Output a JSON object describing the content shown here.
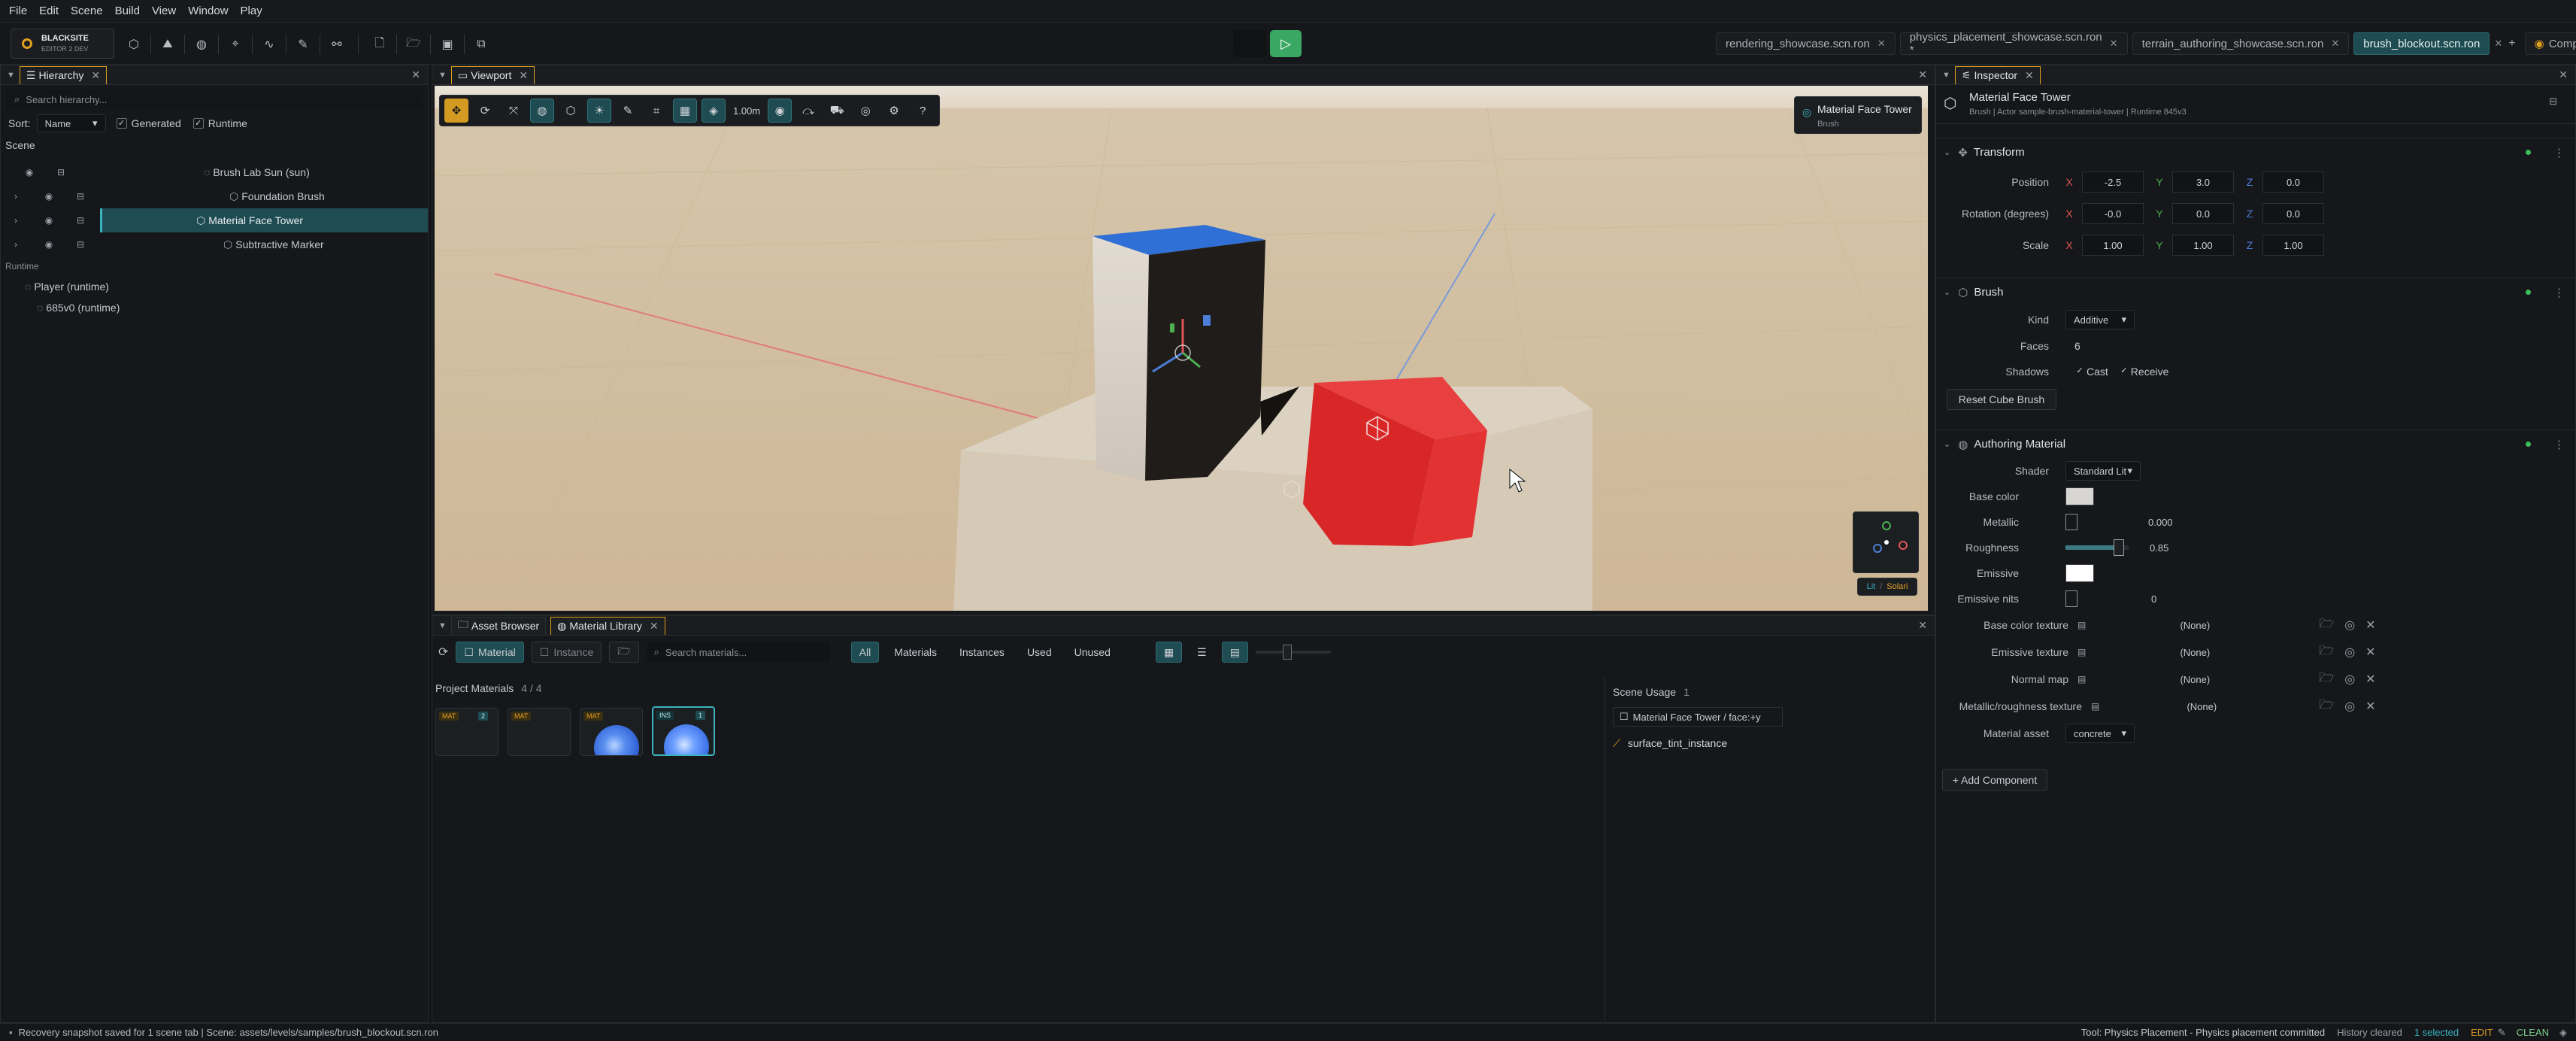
{
  "menubar": {
    "items": [
      "File",
      "Edit",
      "Scene",
      "Build",
      "View",
      "Window",
      "Play"
    ]
  },
  "brand": {
    "name": "BLACKSITE",
    "sub": "EDITOR 2 DEV"
  },
  "doc_tabs": [
    {
      "label": "rendering_showcase.scn.ron",
      "active": false
    },
    {
      "label": "physics_placement_showcase.scn.ron *",
      "active": false
    },
    {
      "label": "terrain_authoring_showcase.scn.ron",
      "active": false
    },
    {
      "label": "brush_blockout.scn.ron",
      "active": true
    }
  ],
  "composition_label": "Composition",
  "hierarchy": {
    "tab": "Hierarchy",
    "search_placeholder": "Search hierarchy...",
    "sort_label": "Sort:",
    "sort_value": "Name",
    "toggle_generated": "Generated",
    "toggle_runtime": "Runtime",
    "scene_header": "Scene",
    "scene_items": [
      {
        "label": "Brush Lab Sun  (sun)"
      },
      {
        "label": "Foundation Brush"
      },
      {
        "label": "Material Face Tower",
        "selected": true
      },
      {
        "label": "Subtractive Marker"
      }
    ],
    "runtime_header": "Runtime",
    "runtime_items": [
      "Player  (runtime)",
      "685v0  (runtime)"
    ]
  },
  "viewport": {
    "tab": "Viewport",
    "snap_value": "1.00m",
    "overlay_title": "Material Face Tower",
    "overlay_sub": "Brush",
    "lit_label": "Lit",
    "solari_label": "Solari"
  },
  "bottom": {
    "tab_assets": "Asset Browser",
    "tab_materials": "Material Library",
    "mode_material": "Material",
    "mode_instance": "Instance",
    "search_placeholder": "Search materials...",
    "filters": [
      "All",
      "Materials",
      "Instances",
      "Used",
      "Unused"
    ],
    "project_label": "Project Materials",
    "project_count": "4  /  4",
    "tiles": [
      {
        "badge": "MAT",
        "badge2": "2",
        "kind": "dark"
      },
      {
        "badge": "MAT",
        "badge2": "",
        "kind": "dark"
      },
      {
        "badge": "MAT",
        "badge2": "",
        "kind": "sphere"
      },
      {
        "badge": "INS",
        "badge2": "1",
        "kind": "sphere-selected"
      }
    ],
    "scene_usage_label": "Scene Usage",
    "scene_usage_count": "1",
    "usage_item": "Material Face Tower / face:+y",
    "instance_name": "surface_tint_instance"
  },
  "inspector": {
    "tab": "Inspector",
    "title": "Material Face Tower",
    "subtitle": "Brush  |  Actor sample-brush-material-tower  |  Runtime 845v3",
    "transform": {
      "header": "Transform",
      "position_label": "Position",
      "rotation_label": "Rotation (degrees)",
      "scale_label": "Scale",
      "position": [
        "-2.5",
        "3.0",
        "0.0"
      ],
      "rotation": [
        "-0.0",
        "0.0",
        "0.0"
      ],
      "scale": [
        "1.00",
        "1.00",
        "1.00"
      ],
      "ax": [
        "X",
        "Y",
        "Z"
      ]
    },
    "brush": {
      "header": "Brush",
      "kind_label": "Kind",
      "kind_value": "Additive",
      "faces_label": "Faces",
      "faces_value": "6",
      "shadows_label": "Shadows",
      "cast_label": "Cast",
      "receive_label": "Receive",
      "reset_button": "Reset Cube Brush"
    },
    "material": {
      "header": "Authoring Material",
      "shader_label": "Shader",
      "shader_value": "Standard Lit",
      "base_color_label": "Base color",
      "metallic_label": "Metallic",
      "metallic_value": "0.000",
      "roughness_label": "Roughness",
      "roughness_value": "0.85",
      "roughness_level": 0.85,
      "emissive_label": "Emissive",
      "emissive_nits_label": "Emissive nits",
      "emissive_nits_value": "0",
      "textures": [
        {
          "label": "Base color texture",
          "value": "(None)"
        },
        {
          "label": "Emissive texture",
          "value": "(None)"
        },
        {
          "label": "Normal map",
          "value": "(None)"
        },
        {
          "label": "Metallic/roughness texture",
          "value": "(None)"
        }
      ],
      "asset_label": "Material asset",
      "asset_value": "concrete"
    },
    "add_component": "+ Add Component"
  },
  "status": {
    "left": "Recovery snapshot saved for 1 scene tab  |  Scene: assets/levels/samples/brush_blockout.scn.ron",
    "tool": "Tool: Physics Placement - Physics placement committed",
    "history": "History cleared",
    "selected": "1 selected",
    "mode": "EDIT",
    "clean": "CLEAN"
  },
  "colors": {
    "accent": "#e0a020",
    "selection": "#1f4c52",
    "play": "#3aa863",
    "cube_red": "#e22a2a",
    "tower_top": "#2f6fd6"
  }
}
